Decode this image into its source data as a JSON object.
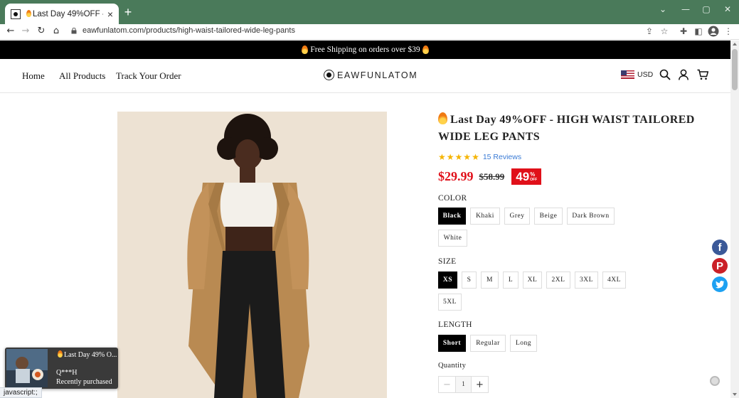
{
  "browser": {
    "tab_title": "Last Day 49%OFF - HIGH WAI",
    "tab_close": "×",
    "new_tab": "+",
    "url": "eawfunlatom.com/products/high-waist-tailored-wide-leg-pants",
    "window_controls": [
      "minimize",
      "restore",
      "close"
    ],
    "status_text": "javascript:;"
  },
  "announcement": {
    "text": "Free Shipping on orders over $39"
  },
  "header": {
    "nav": [
      "Home",
      "All Products",
      "Track Your Order"
    ],
    "logo_text": "EAWFUNLATOM",
    "currency": "USD"
  },
  "product": {
    "title": "Last Day 49%OFF - HIGH WAIST TAILORED WIDE LEG PANTS",
    "rating": 5,
    "reviews": "15 Reviews",
    "price": "$29.99",
    "compare_price": "$58.99",
    "discount_number": "49",
    "discount_pct": "%",
    "discount_off": "OFF",
    "color_label": "COLOR",
    "colors": [
      "Black",
      "Khaki",
      "Grey",
      "Beige",
      "Dark Brown",
      "White"
    ],
    "color_selected": "Black",
    "size_label": "SIZE",
    "sizes": [
      "XS",
      "S",
      "M",
      "L",
      "XL",
      "2XL",
      "3XL",
      "4XL",
      "5XL"
    ],
    "size_selected": "XS",
    "length_label": "LENGTH",
    "lengths": [
      "Short",
      "Regular",
      "Long"
    ],
    "length_selected": "Short",
    "quantity_label": "Quantity",
    "quantity": "1",
    "qty_minus": "−",
    "qty_plus": "+"
  },
  "popup": {
    "title": "Last Day 49% O...",
    "name": "Q***H",
    "status": "Recently purchased"
  },
  "colors": {
    "chrome": "#4a7a5a",
    "price_red": "#e0101a",
    "facebook": "#3b5998",
    "pinterest": "#cb2027",
    "twitter": "#1da1f2",
    "star": "#f5b400"
  }
}
